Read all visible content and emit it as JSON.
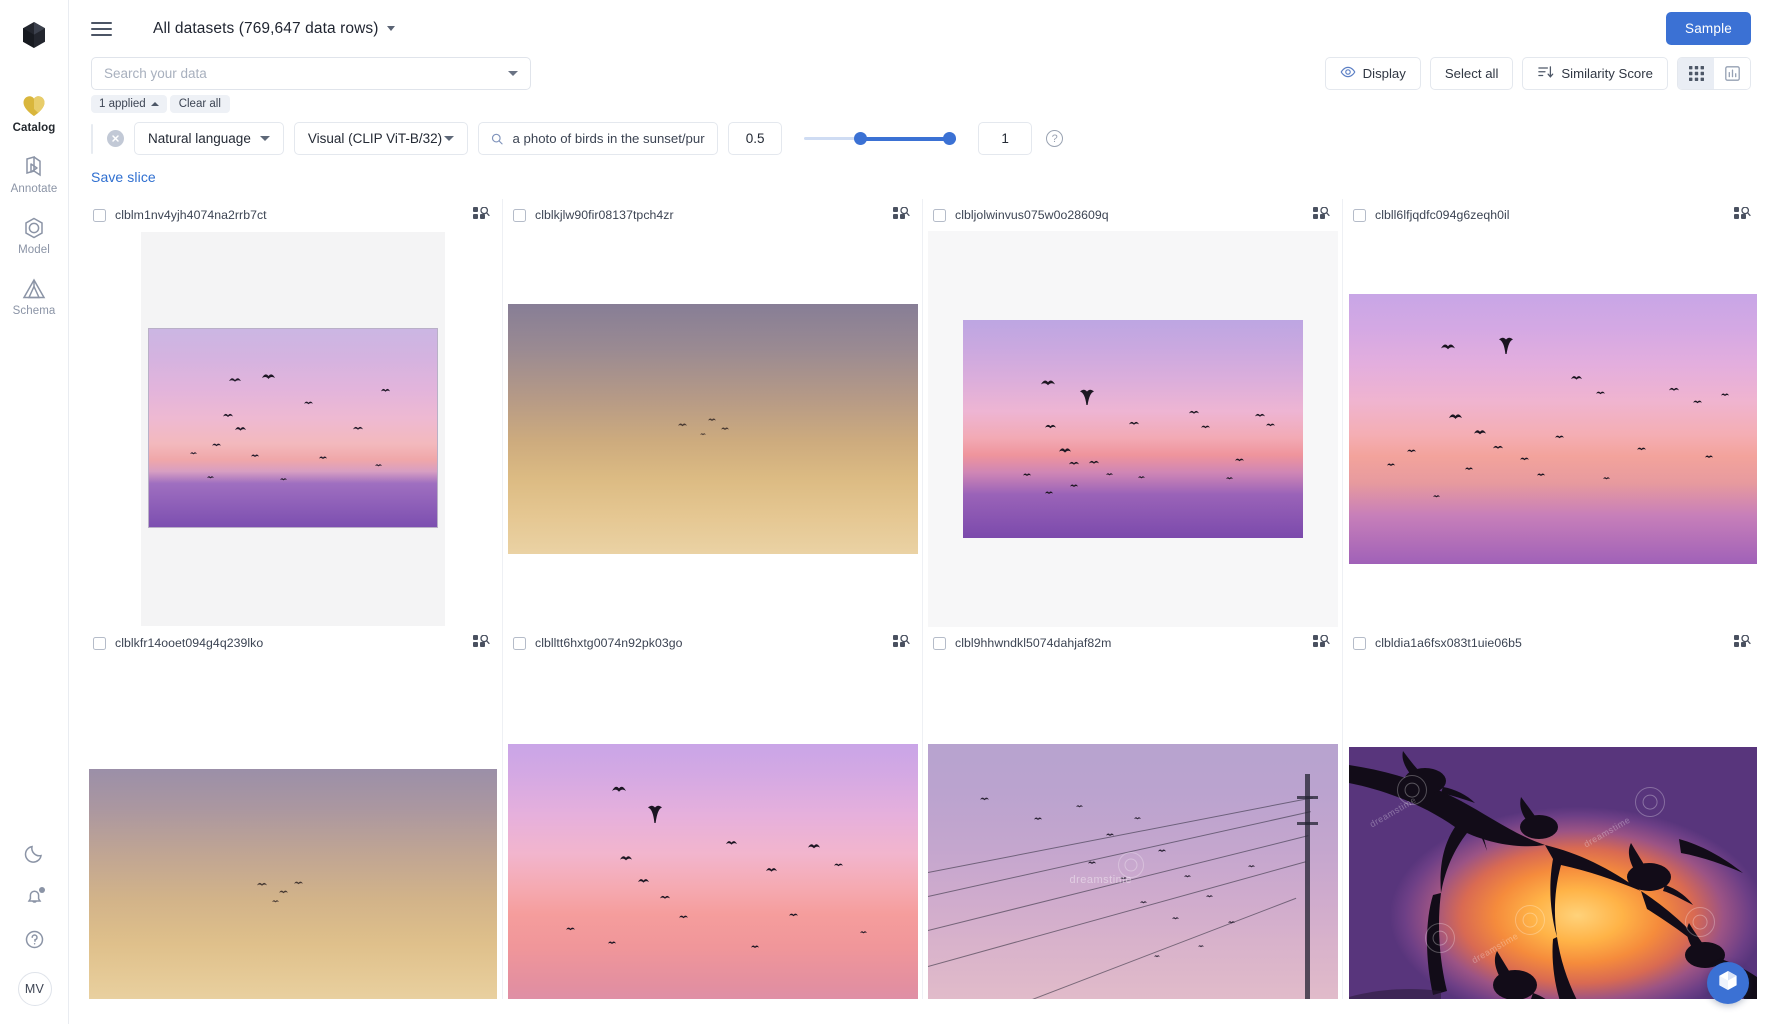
{
  "sidebar": {
    "logo_icon": "cube-logo-icon",
    "items": [
      {
        "label": "Catalog",
        "icon": "catalog-heart-icon",
        "active": true
      },
      {
        "label": "Annotate",
        "icon": "annotate-icon",
        "active": false
      },
      {
        "label": "Model",
        "icon": "model-hexagon-icon",
        "active": false
      },
      {
        "label": "Schema",
        "icon": "schema-triangle-icon",
        "active": false
      }
    ],
    "bottom": [
      {
        "icon": "moon-icon",
        "name": "dark-mode-toggle"
      },
      {
        "icon": "bell-icon",
        "name": "notifications-button"
      },
      {
        "icon": "help-circle-icon",
        "name": "help-button"
      }
    ],
    "avatar_initials": "MV"
  },
  "topbar": {
    "menu_icon": "hamburger-menu-icon",
    "dataset_title": "All datasets (769,647 data rows)",
    "dataset_caret_icon": "chevron-down-icon",
    "sample_label": "Sample"
  },
  "search": {
    "placeholder": "Search your data",
    "value": "",
    "caret_icon": "chevron-down-icon"
  },
  "toolbar": {
    "display_label": "Display",
    "display_icon": "eye-icon",
    "select_all_label": "Select all",
    "sort_label": "Similarity Score",
    "sort_icon": "sort-descending-icon",
    "view_grid_icon": "grid-view-icon",
    "view_chart_icon": "chart-view-icon",
    "active_view": "grid"
  },
  "filters": {
    "applied_label": "1 applied",
    "applied_caret_icon": "chevron-up-icon",
    "clear_all_label": "Clear all",
    "remove_icon": "close-circle-icon",
    "type_label": "Natural language",
    "model_label": "Visual (CLIP ViT-B/32)",
    "query_icon": "search-icon",
    "query_value": "a photo of birds in the sunset/purple/r",
    "threshold_min": "0.5",
    "threshold_max": "1",
    "slider_low": 0.5,
    "slider_high": 1,
    "help_icon": "help-circle-icon",
    "help_glyph": "?",
    "save_slice_label": "Save slice"
  },
  "colors": {
    "accent": "#3b71d4",
    "link": "#2f6fd0",
    "chip_bg": "#eef1f6",
    "border": "#e4e8ee",
    "catalog_yellow": "#d9b63c",
    "text": "#242a35",
    "muted": "#8b94a6"
  },
  "grid": {
    "checkbox_name": "row-select-checkbox",
    "similar_icon": "find-similar-icon",
    "items": [
      {
        "id": "clblm1nv4yjh4074na2rrb7ct",
        "style": "a",
        "orientation": "portrait-frame"
      },
      {
        "id": "clblkjlw90fir08137tpch4zr",
        "style": "b",
        "orientation": "landscape"
      },
      {
        "id": "clbljolwinvus075w0o28609q",
        "style": "c",
        "orientation": "landscape-frame"
      },
      {
        "id": "clbll6lfjqdfc094g6zeqh0il",
        "style": "d",
        "orientation": "landscape-full"
      },
      {
        "id": "clblkfr14ooet094g4q239lko",
        "style": "e",
        "orientation": "landscape"
      },
      {
        "id": "clblltt6hxtg0074n92pk03go",
        "style": "f",
        "orientation": "landscape"
      },
      {
        "id": "clbl9hhwndkl5074dahjaf82m",
        "style": "g",
        "orientation": "landscape-wires"
      },
      {
        "id": "clbldia1a6fsx083t1uie06b5",
        "style": "h",
        "orientation": "landscape-illustration"
      }
    ]
  },
  "fab": {
    "icon": "cube-logo-icon",
    "name": "assistant-fab"
  }
}
